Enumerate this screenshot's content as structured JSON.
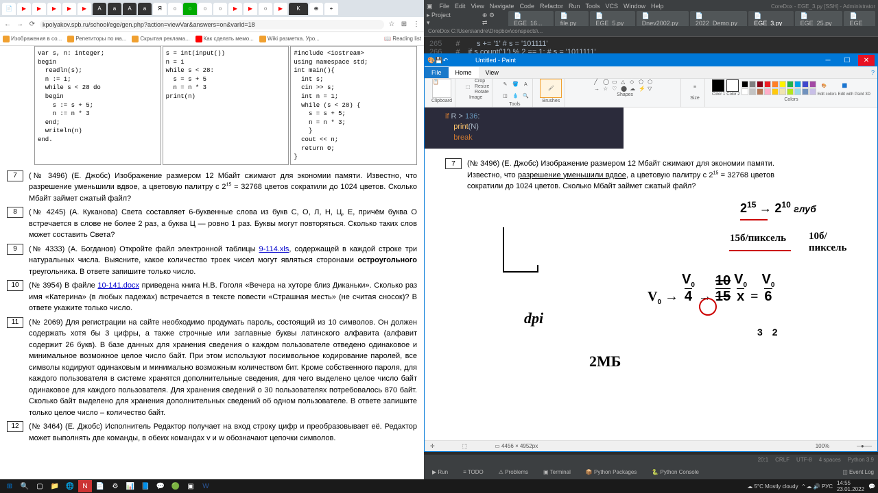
{
  "browser": {
    "url": "kpolyakov.spb.ru/school/ege/gen.php?action=viewVar&answers=on&varId=18",
    "bookmarks": [
      "Изображения в со...",
      "Репетиторы по ма...",
      "Скрытая реклама...",
      "Как сделать мемо...",
      "Wiki разметка. Уро...",
      "Reading list"
    ],
    "code": {
      "col1": "var s, n: integer;\nbegin\n  readln(s);\n  n := 1;\n  while s < 28 do\n  begin\n    s := s + 5;\n    n := n * 3\n  end;\n  writeln(n)\nend.",
      "col2": "s = int(input())\nn = 1\nwhile s < 28:\n  s = s + 5\n  n = n * 3\nprint(n)",
      "col3": "#include <iostream>\nusing namespace std;\nint main(){\n  int s;\n  cin >> s;\n  int n = 1;\n  while (s < 28) {\n    s = s + 5;\n    n = n * 3;\n    }\n  cout << n;\n  return 0;\n}"
    },
    "problems": [
      {
        "n": "7",
        "text": "(№ 3496) (Е. Джобс) Изображение размером 12 Мбайт сжимают для экономии памяти. Известно, что разрешение уменьшили вдвое, а цветовую палитру с 2",
        "sup": "15",
        "text2": " = 32768 цветов сократили до 1024 цветов. Сколько Мбайт займет сжатый файл?"
      },
      {
        "n": "8",
        "text": "(№ 4245) (А. Куканова) Света составляет 6-буквенные слова из букв С, О, Л, Н, Ц, Е, причём буква О встречается в слове не более 2 раз, а буква Ц — ровно 1 раз. Буквы могут повторяться. Сколько таких слов может составить Света?"
      },
      {
        "n": "9",
        "text": "(№ 4333) (А. Богданов) Откройте файл электронной таблицы ",
        "link": "9-114.xls",
        "text2": ", содержащей в каждой строке три натуральных числа. Выясните, какое количество троек чисел могут являться сторонами ",
        "bold": "остроугольного",
        "text3": " треугольника. В ответе запишите только число."
      },
      {
        "n": "10",
        "text": "(№ 3954) В файле ",
        "link": "10-141.docx",
        "text2": " приведена книга Н.В. Гоголя «Вечера на хуторе близ Диканьки». Сколько раз имя «Катерина» (в любых падежах) встречается в тексте повести «Страшная месть» (не считая сносок)? В ответе укажите только число."
      },
      {
        "n": "11",
        "text": "(№ 2069) Для регистрации на сайте необходимо продумать пароль, состоящий из 10 символов. Он должен содержать хотя бы 3 цифры, а также строчные или заглавные буквы латинского алфавита (алфавит содержит 26 букв). В базе данных для хранения сведения о каждом пользователе отведено одинаковое и минимальное возможное целое число байт. При этом используют посимвольное кодирование паролей, все символы кодируют одинаковым и минимально возможным количеством бит. Кроме собственного пароля, для каждого пользователя в системе хранятся дополнительные сведения, для чего выделено целое число байт одинаковое для каждого пользователя. Для хранения сведений о 30 пользователях потребовалось 870 байт. Сколько байт выделено для хранения дополнительных сведений об одном пользователе. В ответе запишите только целое число – количество байт."
      },
      {
        "n": "12",
        "text": "(№ 3464) (Е. Джобс) Исполнитель Редактор получает на вход строку цифр и преобразовывает её. Редактор может выполнять две команды, в обеих командах v и w обозначают цепочки символов."
      }
    ]
  },
  "ide": {
    "menu": [
      "File",
      "Edit",
      "View",
      "Navigate",
      "Code",
      "Refactor",
      "Run",
      "Tools",
      "VCS",
      "Window",
      "Help"
    ],
    "title": "CoreDox - EGE_3.py [SSH] - Administrator",
    "tabs": [
      "EGE_16...",
      "file.py",
      "EGE_5.py",
      "Dnev2002.py",
      "2022_Demo.py",
      "EGE_3.py",
      "EGE_25.py",
      "EGE"
    ],
    "activetab": 5,
    "path": "CoreDox  C:\\Users\\andre\\Dropbox\\conspects\\...",
    "lines": [
      {
        "n": "265",
        "code": "s += '1'  # s = '101111'"
      },
      {
        "n": "266",
        "code": "if s.count('1') % 2 == 1:  # s = '1011111'"
      }
    ],
    "bottabs": [
      "Run",
      "TODO",
      "Problems",
      "Terminal",
      "Python Packages",
      "Python Console"
    ],
    "status": [
      "Event Log",
      "20:1",
      "CRLF",
      "UTF-8",
      "4 spaces",
      "Python 3.9"
    ]
  },
  "paint": {
    "title": "Untitled - Paint",
    "ribbontabs": [
      "File",
      "Home",
      "View"
    ],
    "groups": [
      "Clipboard",
      "Image",
      "Tools",
      "Brushes",
      "Shapes",
      "Size",
      "Colors"
    ],
    "tools": [
      "Paste",
      "Select",
      "Rotate",
      "Resize",
      "Crop"
    ],
    "colors": [
      "#000000",
      "#7f7f7f",
      "#880015",
      "#ed1c24",
      "#ff7f27",
      "#fff200",
      "#22b14c",
      "#00a2e8",
      "#3f48cc",
      "#a349a4",
      "#ffffff",
      "#c3c3c3",
      "#b97a57",
      "#ffaec9",
      "#ffc90e",
      "#efe4b0",
      "#b5e61d",
      "#99d9ea",
      "#7092be",
      "#c8bfe7"
    ],
    "codeimg": {
      "l1": "if R > 136:",
      "l2": "    print(N)",
      "l3": "    break"
    },
    "prob": {
      "n": "7",
      "text": "(№ 3496) (Е. Джобс) Изображение размером 12 Мбайт сжимают для экономии памяти. Известно, что ",
      "under": "разрешение уменьшили вдвое",
      "text2": ", а цветовую палитру с 2",
      "sup": "15",
      "text3": " = 32768 цветов сократили до 1024 цветов. Сколько Мбайт займет сжатый файл?"
    },
    "hw": {
      "e1": "2",
      "e1s": "15",
      "arr1": "→",
      "e2": "2",
      "e2s": "10",
      "e2t": "глуб",
      "b1": "15б/пиксель",
      "b2": "10б/\nпиксель",
      "v0": "V₀",
      "vv": "V₀",
      "d4": "4",
      "r10": "10",
      "r15": "15",
      "vx": "V₀\nx",
      "eq": "=",
      "vf": "V₀\n6",
      "n3": "3",
      "n2": "2",
      "dpi": "dpi",
      "mb": "2МБ"
    },
    "status": {
      "dim": "4456 × 4952px",
      "zoom": "100%"
    }
  },
  "tray": {
    "weather": "5°C Mostly cloudy",
    "time": "14:55",
    "date": "23.01.2022"
  }
}
